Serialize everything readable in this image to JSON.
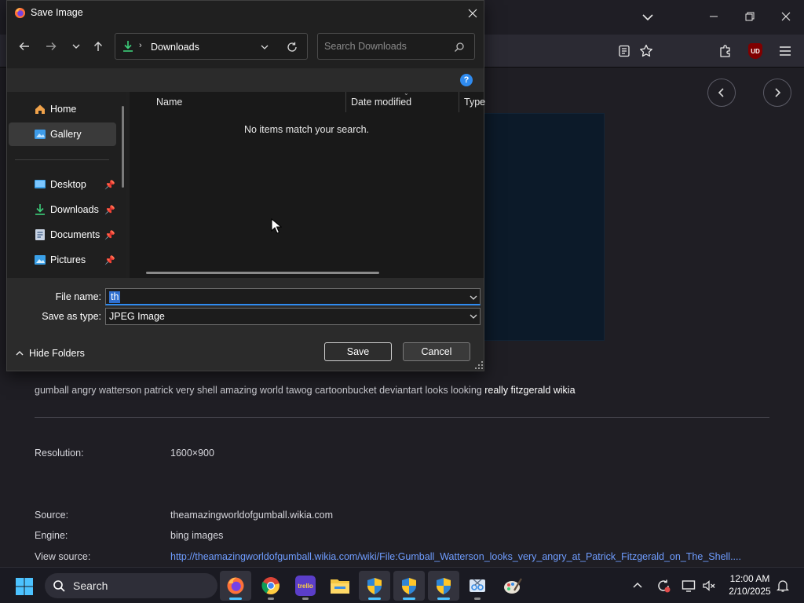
{
  "browser": {
    "tags_text": "gumball angry watterson patrick very shell amazing world tawog cartoonbucket deviantart looks looking ",
    "tags_highlight": "really fitzgerald wikia",
    "info": {
      "resolution_label": "Resolution:",
      "resolution_value": "1600×900",
      "source_label": "Source:",
      "source_value": "theamazingworldofgumball.wikia.com",
      "engine_label": "Engine:",
      "engine_value": "bing images",
      "view_source_label": "View source:",
      "view_source_value": "http://theamazingworldofgumball.wikia.com/wiki/File:Gumball_Watterson_looks_very_angry_at_Patrick_Fitzgerald_on_The_Shell...."
    },
    "ublock_badge": "UD"
  },
  "dialog": {
    "title": "Save Image",
    "address": "Downloads",
    "search_placeholder": "Search Downloads",
    "help_glyph": "?",
    "nav_items": [
      {
        "label": "Home",
        "icon": "home-icon"
      },
      {
        "label": "Gallery",
        "icon": "gallery-icon",
        "selected": true
      },
      {
        "label": "Desktop",
        "icon": "desktop-folder-icon",
        "pinned": true
      },
      {
        "label": "Downloads",
        "icon": "downloads-folder-icon",
        "pinned": true
      },
      {
        "label": "Documents",
        "icon": "documents-folder-icon",
        "pinned": true
      },
      {
        "label": "Pictures",
        "icon": "pictures-folder-icon",
        "pinned": true
      }
    ],
    "columns": [
      "Name",
      "Date modified",
      "Type"
    ],
    "empty_message": "No items match your search.",
    "file_name_label": "File name:",
    "file_name_value": "th",
    "save_type_label": "Save as type:",
    "save_type_value": "JPEG Image",
    "hide_folders_label": "Hide Folders",
    "save_label": "Save",
    "cancel_label": "Cancel"
  },
  "taskbar": {
    "search_label": "Search",
    "apps": [
      "firefox-icon",
      "chrome-icon",
      "trello-icon",
      "file-explorer-icon",
      "shield-icon",
      "shield-icon",
      "shield-icon",
      "snipping-tool-icon",
      "paint-icon"
    ],
    "trello_text": "trello",
    "time": "12:00 AM",
    "date": "2/10/2025"
  },
  "colors": {
    "accent": "#2f8bf0",
    "link": "#6f9dff",
    "taskbar_active": "#4cc2ff"
  }
}
